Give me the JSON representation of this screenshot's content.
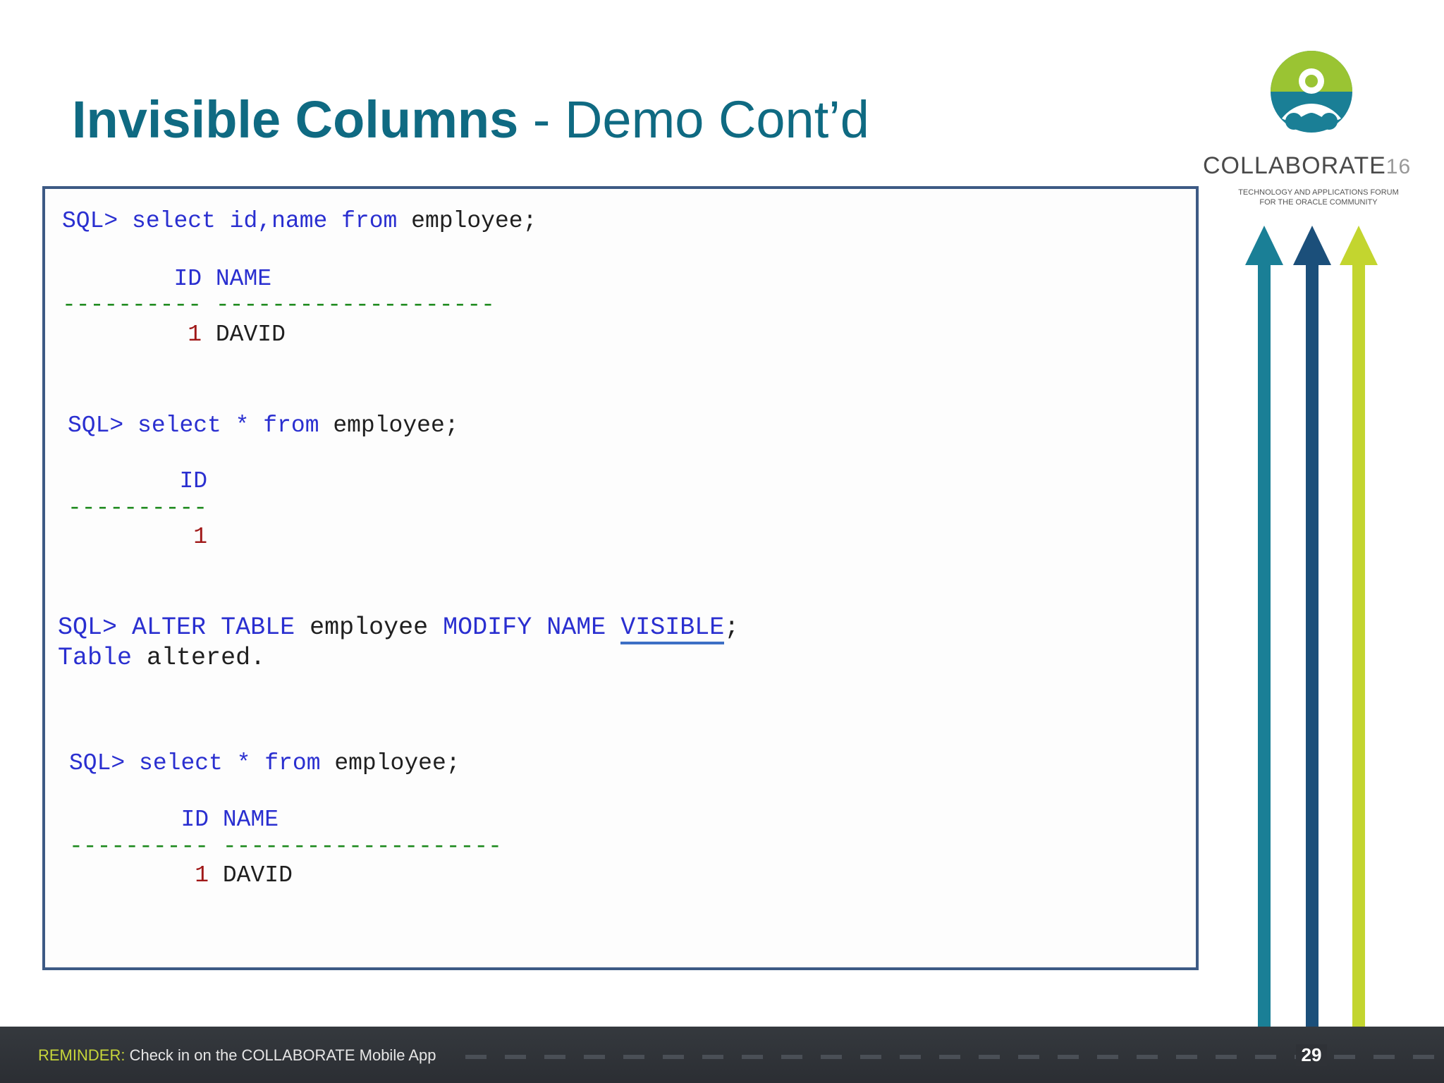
{
  "slide": {
    "title_bold": "Invisible Columns",
    "title_rest": " - Demo Cont’d",
    "page_number": "29"
  },
  "code": {
    "block1": {
      "prompt": "SQL>",
      "kw1": "select",
      "cols": "id,name",
      "kw2": "from",
      "table": "employee;",
      "header_id": "ID",
      "header_name": "NAME",
      "dash1": "----------",
      "dash2": "--------------------",
      "row_id": "1",
      "row_name": "DAVID"
    },
    "block2": {
      "prompt": "SQL>",
      "kw1": "select",
      "star": "*",
      "kw2": "from",
      "table": "employee;",
      "header_id": "ID",
      "dash1": "----------",
      "row_id": "1"
    },
    "block3": {
      "prompt": "SQL>",
      "kw_alter": "ALTER",
      "kw_table": "TABLE",
      "table": "employee",
      "kw_modify": "MODIFY",
      "kw_name": "NAME",
      "kw_visible": "VISIBLE",
      "semicolon": ";",
      "result_kw": "Table",
      "result_rest": "altered."
    },
    "block4": {
      "prompt": "SQL>",
      "kw1": "select",
      "star": "*",
      "kw2": "from",
      "table": "employee;",
      "header_id": "ID",
      "header_name": "NAME",
      "dash1": "----------",
      "dash2": "--------------------",
      "row_id": "1",
      "row_name": "DAVID"
    }
  },
  "logo": {
    "word": "COLLABORATE",
    "year": "16",
    "sub1": "TECHNOLOGY AND APPLICATIONS FORUM",
    "sub2": "FOR THE ORACLE COMMUNITY",
    "colors": {
      "teal": "#1a7f96",
      "navy": "#1b4f7a",
      "lime": "#c3d52f"
    }
  },
  "footer": {
    "label": "REMINDER:",
    "text": " Check in on the COLLABORATE Mobile App"
  }
}
